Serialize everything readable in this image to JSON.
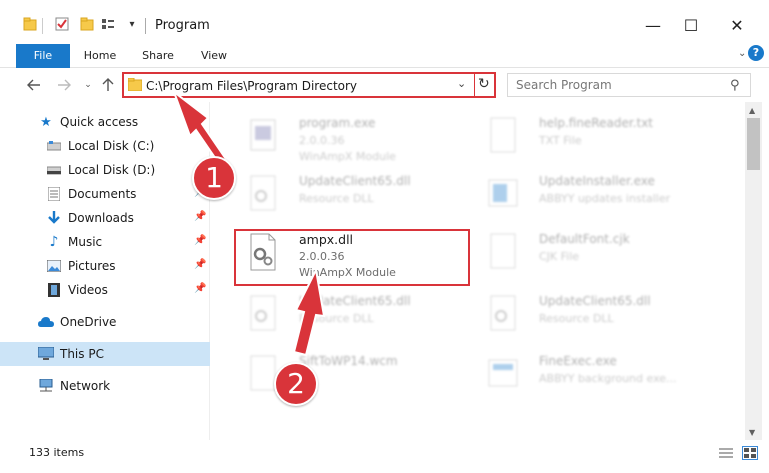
{
  "window": {
    "title": "Program",
    "minimize": "—",
    "maximize": "☐",
    "close": "✕"
  },
  "ribbon": {
    "tabs": [
      "File",
      "Home",
      "Share",
      "View"
    ]
  },
  "address_bar": {
    "path": "C:\\Program Files\\Program Directory"
  },
  "search": {
    "placeholder": "Search Program"
  },
  "sidebar": {
    "items": [
      {
        "label": "Quick access",
        "icon": "star-icon"
      },
      {
        "label": "Local Disk (C:)",
        "icon": "drive-icon"
      },
      {
        "label": "Local Disk (D:)",
        "icon": "drive-icon"
      },
      {
        "label": "Documents",
        "icon": "documents-icon"
      },
      {
        "label": "Downloads",
        "icon": "download-icon"
      },
      {
        "label": "Music",
        "icon": "music-icon"
      },
      {
        "label": "Pictures",
        "icon": "pictures-icon"
      },
      {
        "label": "Videos",
        "icon": "videos-icon"
      },
      {
        "label": "OneDrive",
        "icon": "cloud-icon"
      },
      {
        "label": "This PC",
        "icon": "computer-icon"
      },
      {
        "label": "Network",
        "icon": "network-icon"
      }
    ]
  },
  "files": [
    {
      "name": "program.exe",
      "version": "2.0.0.36",
      "description": "WinAmpX Module"
    },
    {
      "name": "help.fineReader.txt",
      "version": "TXT File",
      "description": ""
    },
    {
      "name": "UpdateClient65.dll",
      "version": "Resource DLL",
      "description": ""
    },
    {
      "name": "UpdateInstaller.exe",
      "version": "ABBYY updates installer",
      "description": ""
    },
    {
      "name": "ampx.dll",
      "version": "2.0.0.36",
      "description": "WinAmpX Module"
    },
    {
      "name": "DefaultFont.cjk",
      "version": "CJK File",
      "description": ""
    },
    {
      "name": "UpdateClient65.dll",
      "version": "Resource DLL",
      "description": ""
    },
    {
      "name": "UpdateClient65.dll",
      "version": "Resource DLL",
      "description": ""
    },
    {
      "name": "SiftToWP14.wcm",
      "version": "",
      "description": ""
    },
    {
      "name": "FineExec.exe",
      "version": "ABBYY background exe...",
      "description": ""
    }
  ],
  "status": {
    "item_count": "133 items"
  },
  "annotations": {
    "step1": "1",
    "step2": "2"
  },
  "colors": {
    "accent_blue": "#1979ca",
    "highlight_red": "#d9343a",
    "selected_bg": "#cce4f7"
  }
}
